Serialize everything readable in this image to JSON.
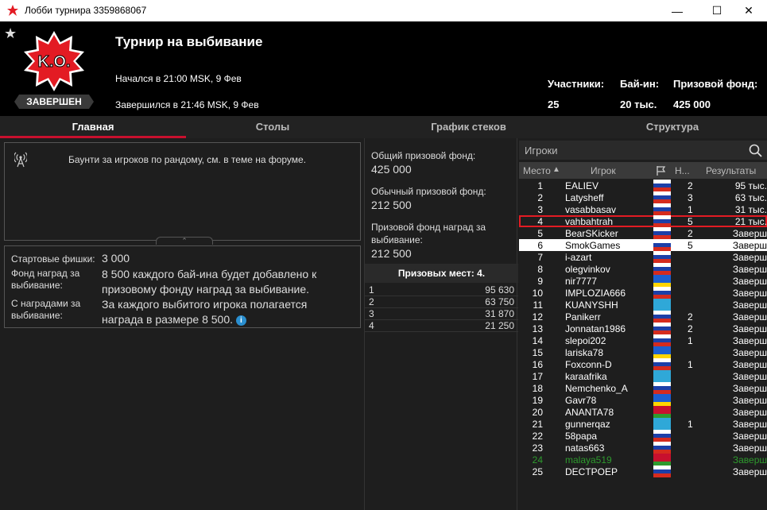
{
  "window": {
    "title": "Лобби турнира 3359868067",
    "min": "—",
    "max": "☐",
    "close": "✕"
  },
  "header": {
    "title": "Турнир на выбивание",
    "started": "Начался в 21:00 MSK, 9 Фев",
    "ended": "Завершился в 21:46 MSK, 9 Фев",
    "status": "ЗАВЕРШЕН",
    "logo_text": "K.O.",
    "participants_label": "Участники:",
    "participants": "25",
    "buyin_label": "Бай-ин:",
    "buyin": "20 тыс.",
    "prize_label": "Призовой фонд:",
    "prize": "425 000"
  },
  "tabs": [
    {
      "label": "Главная"
    },
    {
      "label": "Столы"
    },
    {
      "label": "График стеков"
    },
    {
      "label": "Структура"
    }
  ],
  "announce": "Баунти за игроков по рандому, см. в теме на форуме.",
  "info": {
    "chips_label": "Стартовые фишки:",
    "chips": "3 000",
    "bounty_pool_label": "Фонд наград за выбивание:",
    "bounty_pool": "8 500 каждого бай-ина будет добавлено к призовому фонду наград за выбивание.",
    "bounty_label": "С наградами за выбивание:",
    "bounty": "За каждого выбитого игрока полагается награда в размере 8 500."
  },
  "prizes": {
    "total_label": "Общий призовой фонд:",
    "total": "425 000",
    "regular_label": "Обычный призовой фонд:",
    "regular": "212 500",
    "bounty_label": "Призовой фонд наград за выбивание:",
    "bounty": "212 500",
    "places_label": "Призовых мест: 4.",
    "places": [
      {
        "n": "1",
        "v": "95 630"
      },
      {
        "n": "2",
        "v": "63 750"
      },
      {
        "n": "3",
        "v": "31 870"
      },
      {
        "n": "4",
        "v": "21 250"
      }
    ]
  },
  "players": {
    "search_label": "Игроки",
    "columns": {
      "place": "Место",
      "player": "Игрок",
      "n": "Н...",
      "results": "Результаты"
    },
    "rows": [
      {
        "place": "1",
        "name": "EALIEV",
        "n": "2",
        "result": "95 тыс.",
        "flag": "ru"
      },
      {
        "place": "2",
        "name": "Latysheff",
        "n": "3",
        "result": "63 тыс.",
        "flag": "ru"
      },
      {
        "place": "3",
        "name": "vasabbasav",
        "n": "1",
        "result": "31 тыс.",
        "flag": "ru"
      },
      {
        "place": "4",
        "name": "vahbahtrah",
        "n": "5",
        "result": "21 тыс.",
        "flag": "ru"
      },
      {
        "place": "5",
        "name": "BearSKicker",
        "n": "2",
        "result": "Заверш",
        "flag": "ru"
      },
      {
        "place": "6",
        "name": "SmokGames",
        "n": "5",
        "result": "Заверш",
        "flag": "ru"
      },
      {
        "place": "7",
        "name": "i-azart",
        "n": "",
        "result": "Заверш",
        "flag": "ru"
      },
      {
        "place": "8",
        "name": "olegvinkov",
        "n": "",
        "result": "Заверш",
        "flag": "ru"
      },
      {
        "place": "9",
        "name": "nir7777",
        "n": "",
        "result": "Заверш",
        "flag": "ua"
      },
      {
        "place": "10",
        "name": "IMPLOZIA666",
        "n": "",
        "result": "Заверш",
        "flag": "ru"
      },
      {
        "place": "11",
        "name": "KUANYSHH",
        "n": "",
        "result": "Заверш",
        "flag": "kz"
      },
      {
        "place": "12",
        "name": "Panikerr",
        "n": "2",
        "result": "Заверш",
        "flag": "ru"
      },
      {
        "place": "13",
        "name": "Jonnatan1986",
        "n": "2",
        "result": "Заверш",
        "flag": "ru"
      },
      {
        "place": "14",
        "name": "slepoi202",
        "n": "1",
        "result": "Заверш",
        "flag": "ru"
      },
      {
        "place": "15",
        "name": "lariska78",
        "n": "",
        "result": "Заверш",
        "flag": "ua"
      },
      {
        "place": "16",
        "name": "Foxconn-D",
        "n": "1",
        "result": "Заверш",
        "flag": "ru"
      },
      {
        "place": "17",
        "name": "karaafrika",
        "n": "",
        "result": "Заверш",
        "flag": "kz"
      },
      {
        "place": "18",
        "name": "Nemchenko_A",
        "n": "",
        "result": "Заверш",
        "flag": "ru"
      },
      {
        "place": "19",
        "name": "Gavr78",
        "n": "",
        "result": "Заверш",
        "flag": "ua"
      },
      {
        "place": "20",
        "name": "ANANTA78",
        "n": "",
        "result": "Заверш",
        "flag": "by"
      },
      {
        "place": "21",
        "name": "gunnerqaz",
        "n": "1",
        "result": "Заверш",
        "flag": "kz"
      },
      {
        "place": "22",
        "name": "58papa",
        "n": "",
        "result": "Заверш",
        "flag": "ru"
      },
      {
        "place": "23",
        "name": "natas663",
        "n": "",
        "result": "Заверш",
        "flag": "ru"
      },
      {
        "place": "24",
        "name": "malaya519",
        "n": "",
        "result": "Заверш",
        "flag": "by"
      },
      {
        "place": "25",
        "name": "DECTPOEP",
        "n": "",
        "result": "Заверш",
        "flag": "ru"
      }
    ]
  }
}
